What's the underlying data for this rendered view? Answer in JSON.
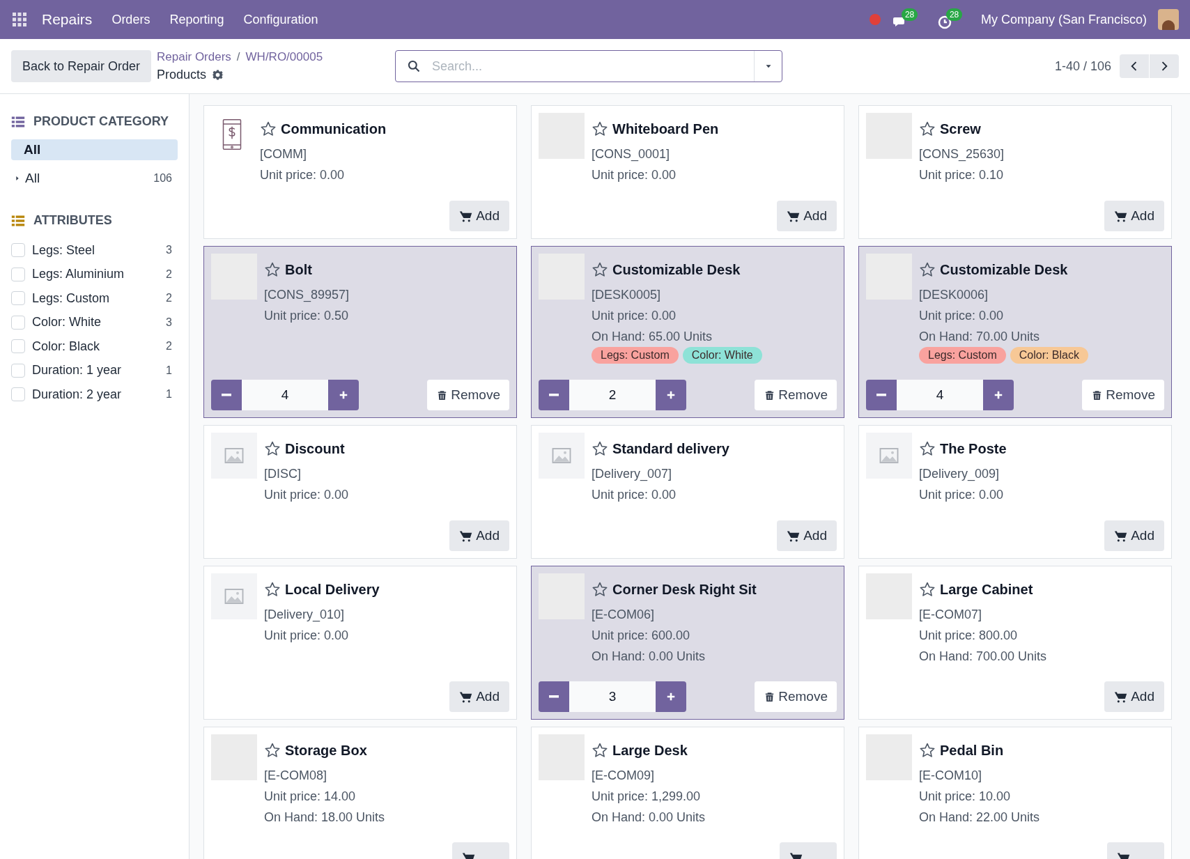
{
  "navbar": {
    "app": "Repairs",
    "menu": [
      "Orders",
      "Reporting",
      "Configuration"
    ],
    "messages_count": "28",
    "activities_count": "28",
    "company": "My Company (San Francisco)"
  },
  "control_panel": {
    "back_button": "Back to Repair Order",
    "breadcrumbs": [
      "Repair Orders",
      "WH/RO/00005"
    ],
    "breadcrumb_separator": "/",
    "title": "Products",
    "search": {
      "placeholder": "Search..."
    },
    "pager": "1-40 / 106"
  },
  "sidebar": {
    "category_title": "PRODUCT CATEGORY",
    "categories": [
      {
        "label": "All",
        "selected": true,
        "expandable": false
      },
      {
        "label": "All",
        "count": "106",
        "selected": false,
        "expandable": true
      }
    ],
    "attributes_title": "ATTRIBUTES",
    "attributes": [
      {
        "label": "Legs: Steel",
        "count": "3",
        "checked": false
      },
      {
        "label": "Legs: Aluminium",
        "count": "2",
        "checked": false
      },
      {
        "label": "Legs: Custom",
        "count": "2",
        "checked": false
      },
      {
        "label": "Color: White",
        "count": "3",
        "checked": false
      },
      {
        "label": "Color: Black",
        "count": "2",
        "checked": false
      },
      {
        "label": "Duration: 1 year",
        "count": "1",
        "checked": false
      },
      {
        "label": "Duration: 2 year",
        "count": "1",
        "checked": false
      }
    ]
  },
  "products": [
    {
      "name": "Communication",
      "code": "[COMM]",
      "price": "Unit price: 0.00",
      "kind": "service",
      "selected": false,
      "add": "Add"
    },
    {
      "name": "Whiteboard Pen",
      "code": "[CONS_0001]",
      "price": "Unit price: 0.00",
      "kind": "photo",
      "selected": false,
      "add": "Add"
    },
    {
      "name": "Screw",
      "code": "[CONS_25630]",
      "price": "Unit price: 0.10",
      "kind": "photo",
      "selected": false,
      "add": "Add"
    },
    {
      "name": "Bolt",
      "code": "[CONS_89957]",
      "price": "Unit price: 0.50",
      "kind": "photo",
      "selected": true,
      "quantity": "4",
      "remove": "Remove"
    },
    {
      "name": "Customizable Desk",
      "code": "[DESK0005]",
      "price": "Unit price: 0.00",
      "on_hand": "On Hand: 65.00 Units",
      "tags": [
        {
          "label": "Legs: Custom",
          "color": "#f9a29e"
        },
        {
          "label": "Color: White",
          "color": "#8ee2d7"
        }
      ],
      "kind": "photo",
      "selected": true,
      "quantity": "2",
      "remove": "Remove"
    },
    {
      "name": "Customizable Desk",
      "code": "[DESK0006]",
      "price": "Unit price: 0.00",
      "on_hand": "On Hand: 70.00 Units",
      "tags": [
        {
          "label": "Legs: Custom",
          "color": "#f9a29e"
        },
        {
          "label": "Color: Black",
          "color": "#f7c896"
        }
      ],
      "kind": "photo",
      "selected": true,
      "quantity": "4",
      "remove": "Remove"
    },
    {
      "name": "Discount",
      "code": "[DISC]",
      "price": "Unit price: 0.00",
      "kind": "noimage",
      "selected": false,
      "add": "Add"
    },
    {
      "name": "Standard delivery",
      "code": "[Delivery_007]",
      "price": "Unit price: 0.00",
      "kind": "noimage",
      "selected": false,
      "add": "Add"
    },
    {
      "name": "The Poste",
      "code": "[Delivery_009]",
      "price": "Unit price: 0.00",
      "kind": "noimage",
      "selected": false,
      "add": "Add"
    },
    {
      "name": "Local Delivery",
      "code": "[Delivery_010]",
      "price": "Unit price: 0.00",
      "kind": "noimage",
      "selected": false,
      "add": "Add"
    },
    {
      "name": "Corner Desk Right Sit",
      "code": "[E-COM06]",
      "price": "Unit price: 600.00",
      "on_hand": "On Hand: 0.00 Units",
      "kind": "photo",
      "selected": true,
      "quantity": "3",
      "remove": "Remove"
    },
    {
      "name": "Large Cabinet",
      "code": "[E-COM07]",
      "price": "Unit price: 800.00",
      "on_hand": "On Hand: 700.00 Units",
      "kind": "photo",
      "selected": false,
      "add": "Add"
    },
    {
      "name": "Storage Box",
      "code": "[E-COM08]",
      "price": "Unit price: 14.00",
      "on_hand": "On Hand: 18.00 Units",
      "kind": "photo",
      "selected": false
    },
    {
      "name": "Large Desk",
      "code": "[E-COM09]",
      "price": "Unit price: 1,299.00",
      "on_hand": "On Hand: 0.00 Units",
      "kind": "photo",
      "selected": false
    },
    {
      "name": "Pedal Bin",
      "code": "[E-COM10]",
      "price": "Unit price: 10.00",
      "on_hand": "On Hand: 22.00 Units",
      "kind": "photo",
      "selected": false
    }
  ]
}
